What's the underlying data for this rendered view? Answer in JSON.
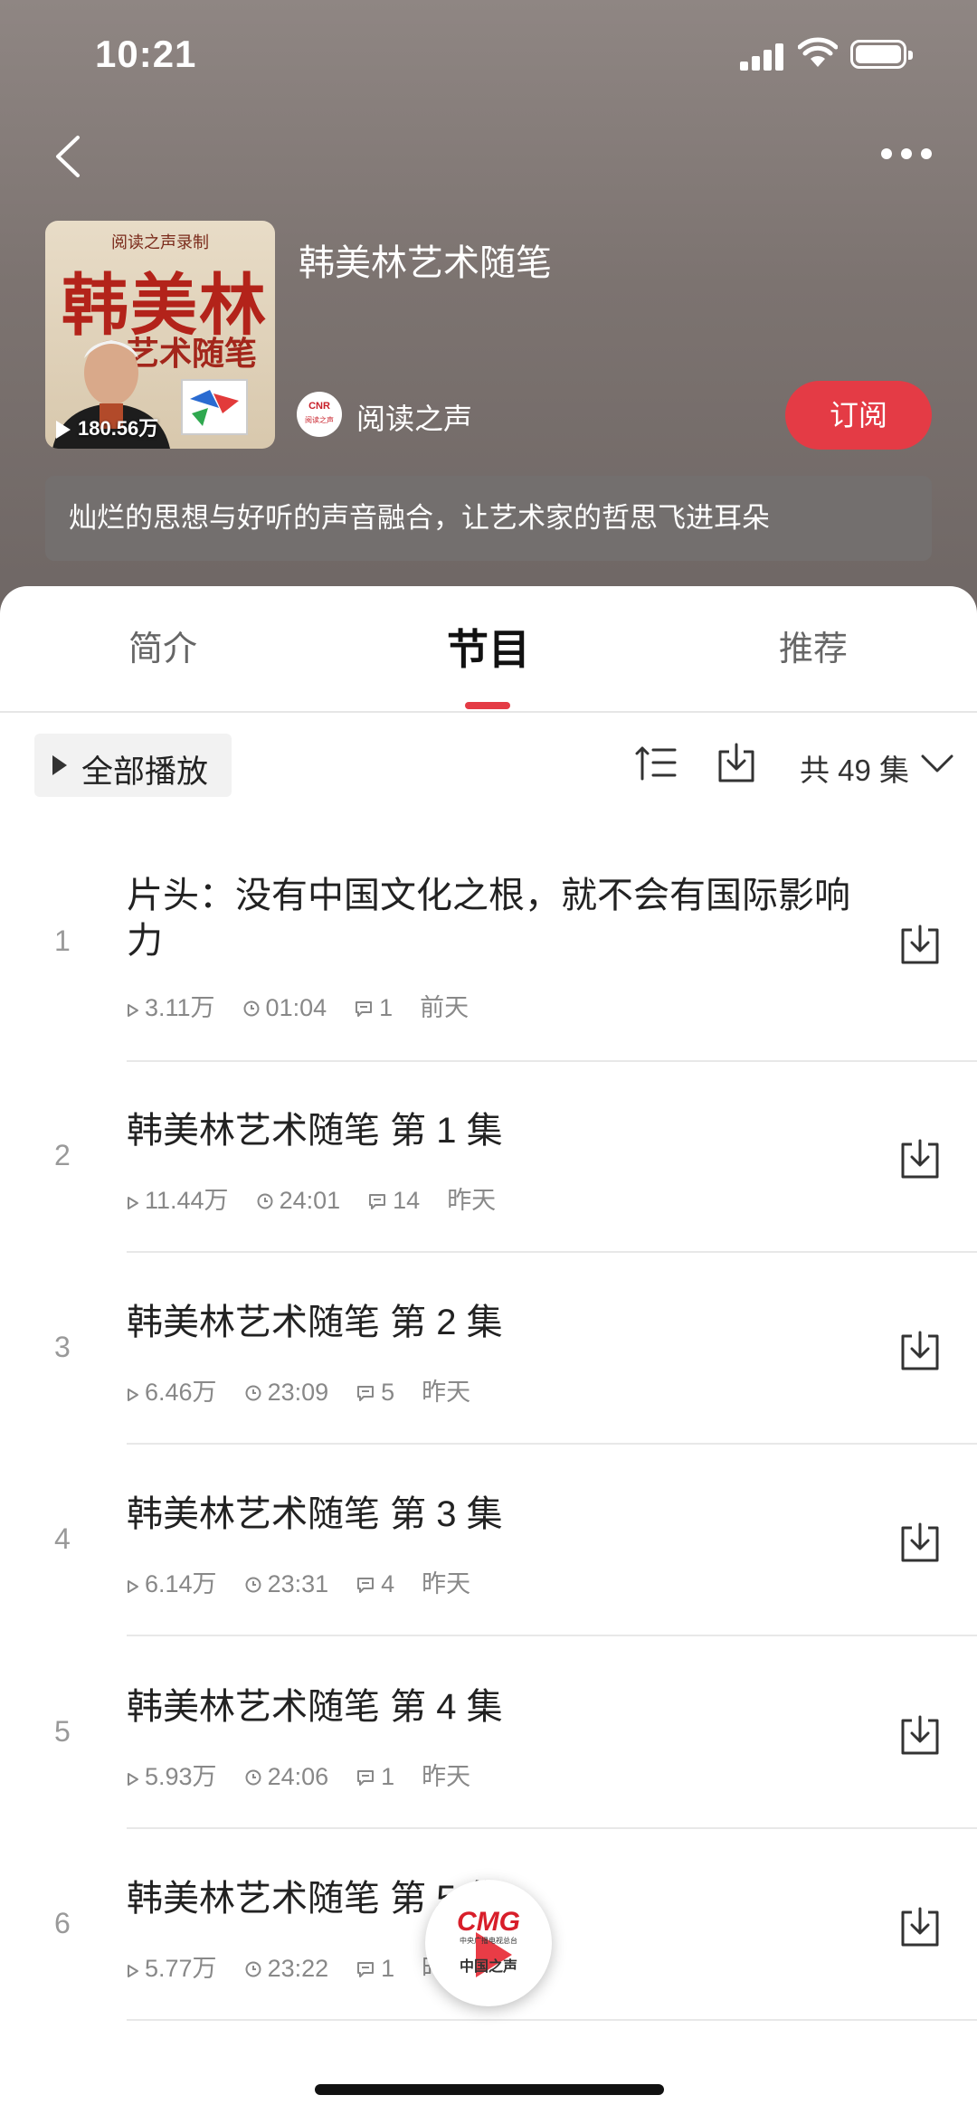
{
  "status": {
    "time": "10:21"
  },
  "header": {
    "title": "韩美林艺术随笔",
    "cover": {
      "top_text": "阅读之声录制",
      "big_text": "韩美林",
      "sub_text": "艺术随笔",
      "play_count": "180.56万"
    },
    "publisher": {
      "name": "阅读之声",
      "logo_text": "CNR",
      "logo_sub": "阅读之声"
    },
    "subscribe_label": "订阅",
    "description": "灿烂的思想与好听的声音融合，让艺术家的哲思飞进耳朵"
  },
  "tabs": [
    {
      "label": "简介"
    },
    {
      "label": "节目",
      "active": true
    },
    {
      "label": "推荐"
    }
  ],
  "toolbar": {
    "play_all": "全部播放",
    "count": "共 49 集"
  },
  "episodes": [
    {
      "num": "1",
      "title": "片头：没有中国文化之根，就不会有国际影响力",
      "plays": "3.11万",
      "duration": "01:04",
      "comments": "1",
      "date": "前天"
    },
    {
      "num": "2",
      "title": "韩美林艺术随笔 第 1 集",
      "plays": "11.44万",
      "duration": "24:01",
      "comments": "14",
      "date": "昨天"
    },
    {
      "num": "3",
      "title": "韩美林艺术随笔 第 2 集",
      "plays": "6.46万",
      "duration": "23:09",
      "comments": "5",
      "date": "昨天"
    },
    {
      "num": "4",
      "title": "韩美林艺术随笔 第 3 集",
      "plays": "6.14万",
      "duration": "23:31",
      "comments": "4",
      "date": "昨天"
    },
    {
      "num": "5",
      "title": "韩美林艺术随笔 第 4 集",
      "plays": "5.93万",
      "duration": "24:06",
      "comments": "1",
      "date": "昨天"
    },
    {
      "num": "6",
      "title": "韩美林艺术随笔 第 5 集",
      "plays": "5.77万",
      "duration": "23:22",
      "comments": "1",
      "date": "昨天"
    }
  ],
  "mini_player": {
    "brand": "CMG",
    "line1": "中央广播电视总台",
    "line2": "中国之声"
  },
  "icons": {
    "back": "chevron-left-icon",
    "more": "more-dots-icon",
    "sort": "sort-icon",
    "download": "download-icon",
    "expand": "chevron-down-icon",
    "play": "play-icon",
    "clock": "clock-icon",
    "comment": "comment-icon"
  },
  "colors": {
    "accent": "#e43b45",
    "hero_bg": "#7f7673"
  }
}
